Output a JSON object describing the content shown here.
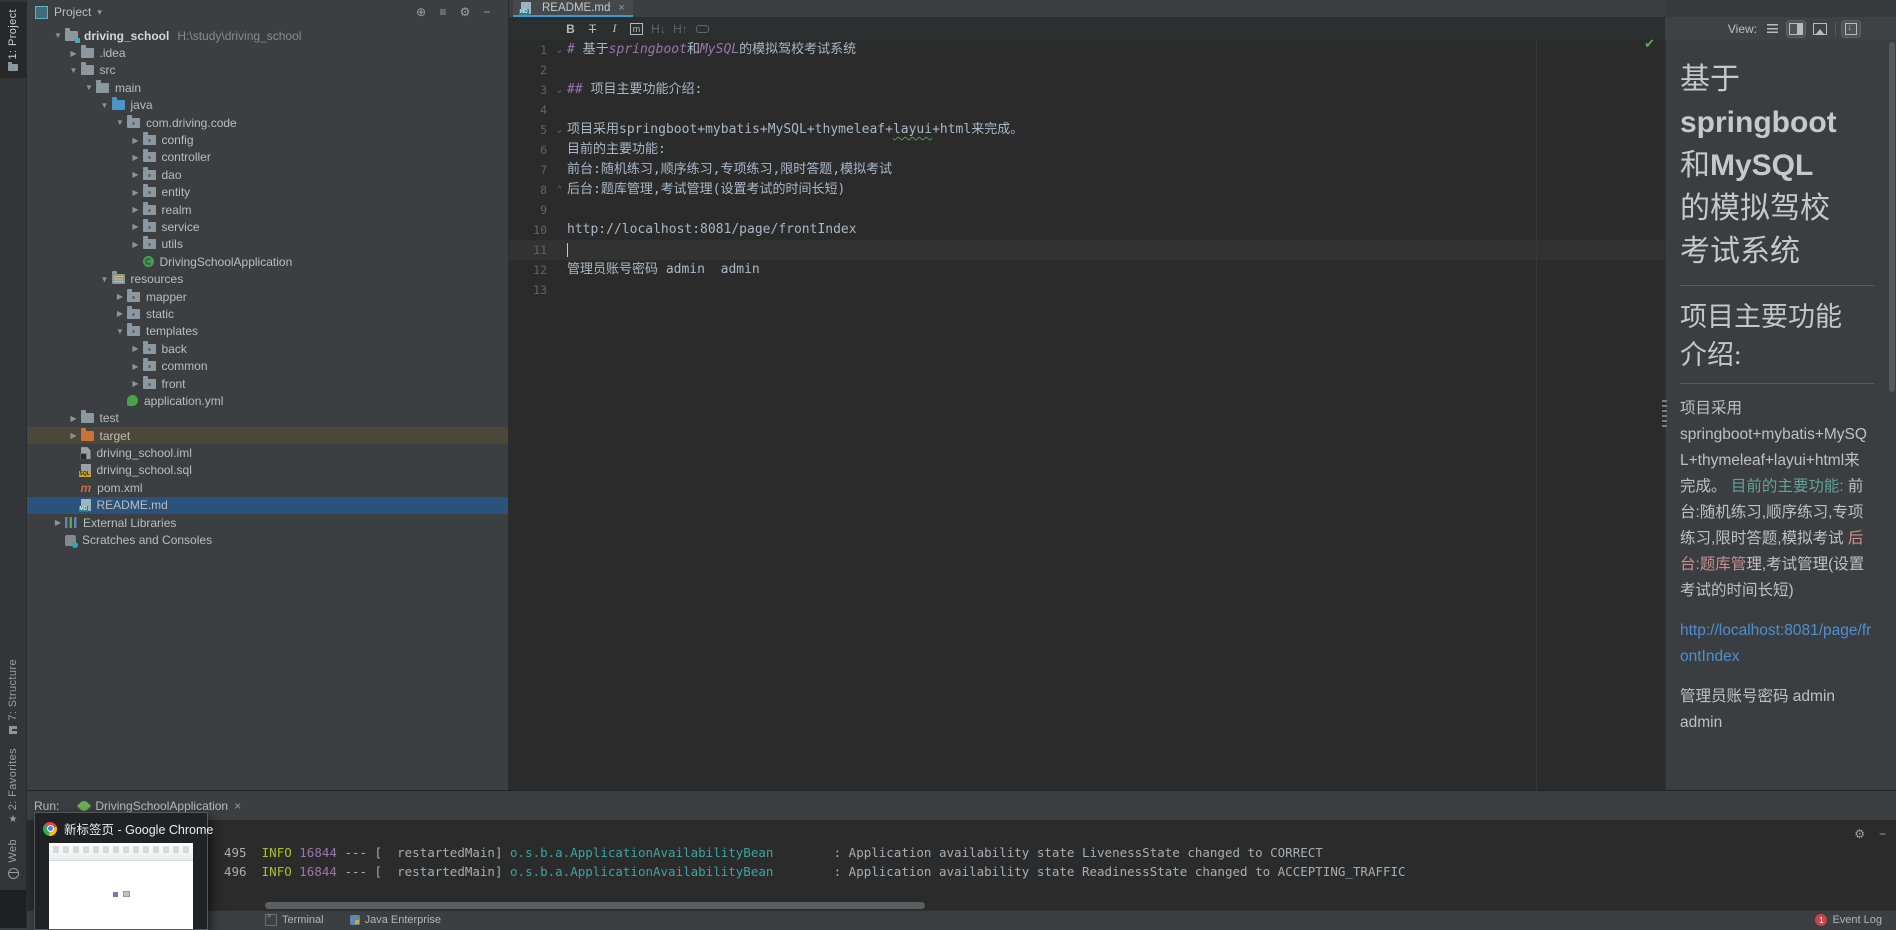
{
  "colors": {
    "panel_bg": "#3c3f41",
    "editor_bg": "#2b2b2b",
    "preview_bg": "#3b3e40",
    "tab_underline": "#3d9ad9",
    "selection_blue": "#2a527a",
    "excluded_row": "#4b483a",
    "keyword_purple": "#9876aa",
    "link_blue": "#4e8fd0",
    "log_info_yellow": "#a8c023",
    "log_pid_purple": "#9876aa",
    "log_class_teal": "#3aa4a0",
    "check_green": "#5cad5c",
    "badge_red": "#c9434a",
    "target_folder_orange": "#c9733a",
    "java_folder_blue": "#4d94c9"
  },
  "left_strip": {
    "top": [
      {
        "label": "1: Project",
        "icon": "folder",
        "active": true
      }
    ],
    "bottom": [
      {
        "label": "7: Structure",
        "icon": "structure"
      },
      {
        "label": "2: Favorites",
        "icon": "star"
      },
      {
        "label": "Web",
        "icon": "globe"
      }
    ]
  },
  "project_panel": {
    "title": "Project",
    "caret": "▾",
    "header_icons": [
      {
        "name": "locate-icon",
        "glyph": "⊕"
      },
      {
        "name": "collapse-all-icon",
        "glyph": "≡"
      },
      {
        "name": "settings-gear-icon",
        "glyph": "⚙"
      },
      {
        "name": "hide-panel-icon",
        "glyph": "−"
      }
    ],
    "tree": [
      {
        "label": "driving_school",
        "path": "H:\\study\\driving_school",
        "level": 0,
        "arrow": "down",
        "icon": "project-folder",
        "bold": true
      },
      {
        "label": ".idea",
        "level": 1,
        "arrow": "right",
        "icon": "folder"
      },
      {
        "label": "src",
        "level": 1,
        "arrow": "down",
        "icon": "folder"
      },
      {
        "label": "main",
        "level": 2,
        "arrow": "down",
        "icon": "folder"
      },
      {
        "label": "java",
        "level": 3,
        "arrow": "down",
        "icon": "java-folder"
      },
      {
        "label": "com.driving.code",
        "level": 4,
        "arrow": "down",
        "icon": "package"
      },
      {
        "label": "config",
        "level": 5,
        "arrow": "right",
        "icon": "package"
      },
      {
        "label": "controller",
        "level": 5,
        "arrow": "right",
        "icon": "package"
      },
      {
        "label": "dao",
        "level": 5,
        "arrow": "right",
        "icon": "package"
      },
      {
        "label": "entity",
        "level": 5,
        "arrow": "right",
        "icon": "package"
      },
      {
        "label": "realm",
        "level": 5,
        "arrow": "right",
        "icon": "package"
      },
      {
        "label": "service",
        "level": 5,
        "arrow": "right",
        "icon": "package"
      },
      {
        "label": "utils",
        "level": 5,
        "arrow": "right",
        "icon": "package"
      },
      {
        "label": "DrivingSchoolApplication",
        "level": 5,
        "arrow": "none",
        "icon": "spring-class"
      },
      {
        "label": "resources",
        "level": 3,
        "arrow": "down",
        "icon": "resources-folder"
      },
      {
        "label": "mapper",
        "level": 4,
        "arrow": "right",
        "icon": "package"
      },
      {
        "label": "static",
        "level": 4,
        "arrow": "right",
        "icon": "package"
      },
      {
        "label": "templates",
        "level": 4,
        "arrow": "down",
        "icon": "package"
      },
      {
        "label": "back",
        "level": 5,
        "arrow": "right",
        "icon": "package"
      },
      {
        "label": "common",
        "level": 5,
        "arrow": "right",
        "icon": "package"
      },
      {
        "label": "front",
        "level": 5,
        "arrow": "right",
        "icon": "package"
      },
      {
        "label": "application.yml",
        "level": 4,
        "arrow": "none",
        "icon": "yml"
      },
      {
        "label": "test",
        "level": 1,
        "arrow": "right",
        "icon": "folder"
      },
      {
        "label": "target",
        "level": 1,
        "arrow": "right",
        "icon": "target-folder",
        "row": "excluded"
      },
      {
        "label": "driving_school.iml",
        "level": 1,
        "arrow": "none",
        "icon": "iml"
      },
      {
        "label": "driving_school.sql",
        "level": 1,
        "arrow": "none",
        "icon": "sql"
      },
      {
        "label": "pom.xml",
        "level": 1,
        "arrow": "none",
        "icon": "maven"
      },
      {
        "label": "README.md",
        "level": 1,
        "arrow": "none",
        "icon": "md",
        "row": "selected"
      },
      {
        "label": "External Libraries",
        "level": 0,
        "arrow": "right",
        "icon": "libraries"
      },
      {
        "label": "Scratches and Consoles",
        "level": 0,
        "arrow": "none",
        "icon": "scratches"
      }
    ]
  },
  "editor": {
    "tab": {
      "title": "README.md",
      "close": "×"
    },
    "md_toolbar": [
      {
        "name": "bold-icon",
        "glyph": "B",
        "cls": "bold"
      },
      {
        "name": "strikethrough-icon",
        "glyph": "T",
        "cls": "strike"
      },
      {
        "name": "italic-icon",
        "glyph": "I",
        "cls": "italic"
      },
      {
        "name": "code-span-icon",
        "glyph": "m",
        "cls": "code"
      },
      {
        "name": "header-down-icon",
        "glyph": "H↓",
        "cls": "dim"
      },
      {
        "name": "header-up-icon",
        "glyph": "H↑",
        "cls": "dim"
      },
      {
        "name": "link-icon",
        "glyph": "",
        "cls": "dim link"
      }
    ],
    "inspection_check": "✔",
    "lines": [
      {
        "fold": "open",
        "segs": [
          {
            "t": "# ",
            "s": "kw"
          },
          {
            "t": "基于",
            "s": "p"
          },
          {
            "t": "springboot",
            "s": "kw"
          },
          {
            "t": "和",
            "s": "p"
          },
          {
            "t": "MySQL",
            "s": "kw"
          },
          {
            "t": "的模拟驾校考试系统",
            "s": "p"
          }
        ]
      },
      {
        "segs": []
      },
      {
        "fold": "open",
        "segs": [
          {
            "t": "## ",
            "s": "kw"
          },
          {
            "t": "项目主要功能介绍:",
            "s": "p"
          }
        ]
      },
      {
        "segs": []
      },
      {
        "fold": "open",
        "segs": [
          {
            "t": "项目采用springboot+mybatis+MySQL+thymeleaf+",
            "s": "p"
          },
          {
            "t": "layui",
            "s": "typo"
          },
          {
            "t": "+html来完成。",
            "s": "p"
          }
        ]
      },
      {
        "segs": [
          {
            "t": "目前的主要功能:",
            "s": "p"
          }
        ]
      },
      {
        "segs": [
          {
            "t": "前台:随机练习,顺序练习,专项练习,限时答题,模拟考试",
            "s": "p"
          }
        ]
      },
      {
        "fold": "end",
        "segs": [
          {
            "t": "后台:题库管理,考试管理(设置考试的时间长短)",
            "s": "p"
          }
        ]
      },
      {
        "segs": []
      },
      {
        "segs": [
          {
            "t": "http://localhost:8081/page/frontIndex",
            "s": "p"
          }
        ]
      },
      {
        "cur": true,
        "segs": []
      },
      {
        "segs": [
          {
            "t": "管理员账号密码 admin  admin",
            "s": "p"
          }
        ]
      },
      {
        "segs": []
      }
    ]
  },
  "preview_controls": {
    "view_label": "View:",
    "icons": [
      {
        "name": "view-editor-only-icon",
        "cls": "i-rows",
        "pressed": false
      },
      {
        "name": "view-editor-and-preview-icon",
        "cls": "i-split",
        "pressed": true
      },
      {
        "name": "view-preview-only-icon",
        "cls": "i-image",
        "pressed": false
      },
      {
        "name": "auto-scroll-preview-icon",
        "cls": "i-autoscroll",
        "pressed": true
      }
    ]
  },
  "preview": {
    "h1_lines": [
      [
        {
          "t": "基于"
        }
      ],
      [
        {
          "t": "springboot",
          "b": true
        }
      ],
      [
        {
          "t": "和"
        },
        {
          "t": "MySQL",
          "b": true
        }
      ],
      [
        {
          "t": "的模拟驾校"
        }
      ],
      [
        {
          "t": "考试系统"
        }
      ]
    ],
    "h2": "项目主要功能介绍:",
    "p1": [
      {
        "t": "项目采用springboot+mybatis+MySQL+thymeleaf+layui+html来完成。 "
      },
      {
        "t": "目前的主要功能:",
        "c": "teal"
      },
      {
        "t": " 前台:随机练习,顺序练习,专项练习,限时答题,模拟考试 "
      },
      {
        "t": "后台:题库管",
        "c": "rose"
      },
      {
        "t": "理,考试管理(设置考试的时间长短)"
      }
    ],
    "link": "http://localhost:8081/page/frontIndex",
    "p2": "管理员账号密码 admin admin"
  },
  "run_panel": {
    "label": "Run:",
    "tab": {
      "title": "DrivingSchoolApplication",
      "close": "×"
    },
    "header_icons": [
      {
        "name": "run-settings-gear-icon",
        "glyph": "⚙"
      },
      {
        "name": "run-hide-icon",
        "glyph": "−"
      }
    ],
    "tool_icons": [
      {
        "name": "rerun-icon",
        "cls": "rt-rerun"
      },
      {
        "name": "stop-icon",
        "cls": "rt-stop"
      },
      {
        "name": "restart-frames-icon",
        "cls": "rt-bars"
      },
      {
        "name": "expand-icon",
        "cls": "rt-more",
        "glyph": "≫"
      }
    ],
    "logs": [
      [
        {
          "t": "495  ",
          "c": "g"
        },
        {
          "t": "INFO",
          "c": "info"
        },
        {
          "t": " ",
          "c": "g"
        },
        {
          "t": "16844",
          "c": "pid"
        },
        {
          "t": " --- [  restartedMain] ",
          "c": "g"
        },
        {
          "t": "o.s.b.a.ApplicationAvailabilityBean",
          "c": "cls"
        },
        {
          "t": "        : Application availability state LivenessState changed to CORRECT",
          "c": "g"
        }
      ],
      [
        {
          "t": "496  ",
          "c": "g"
        },
        {
          "t": "INFO",
          "c": "info"
        },
        {
          "t": " ",
          "c": "g"
        },
        {
          "t": "16844",
          "c": "pid"
        },
        {
          "t": " --- [  restartedMain] ",
          "c": "g"
        },
        {
          "t": "o.s.b.a.ApplicationAvailabilityBean",
          "c": "cls"
        },
        {
          "t": "        : Application availability state ReadinessState changed to ACCEPTING_TRAFFIC",
          "c": "g"
        }
      ]
    ]
  },
  "bottom_bar": {
    "left": [
      {
        "label": "Terminal",
        "icon": "terminal"
      },
      {
        "label": "Java Enterprise",
        "icon": "javaee"
      }
    ],
    "right": {
      "label": "Event Log",
      "badge": "1"
    }
  },
  "chrome_popup": {
    "title": "新标签页 - Google Chrome"
  }
}
